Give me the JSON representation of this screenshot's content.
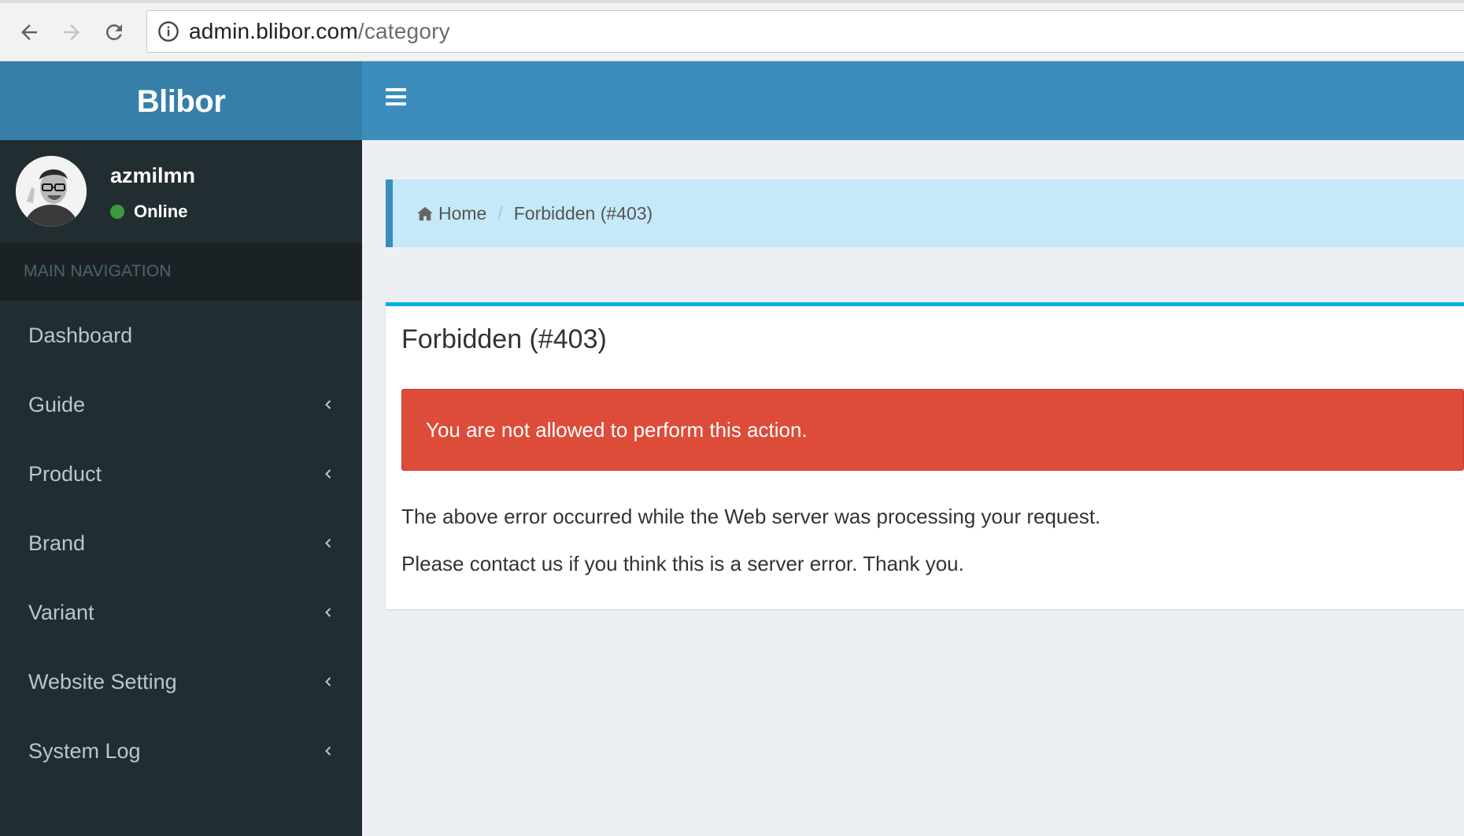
{
  "browser": {
    "url_host": "admin.blibor.com",
    "url_path": "/category"
  },
  "header": {
    "logo": "Blibor"
  },
  "sidebar": {
    "user": {
      "name": "azmilmn",
      "status": "Online"
    },
    "nav_header": "MAIN NAVIGATION",
    "items": [
      {
        "label": "Dashboard",
        "has_chevron": false
      },
      {
        "label": "Guide",
        "has_chevron": true
      },
      {
        "label": "Product",
        "has_chevron": true
      },
      {
        "label": "Brand",
        "has_chevron": true
      },
      {
        "label": "Variant",
        "has_chevron": true
      },
      {
        "label": "Website Setting",
        "has_chevron": true
      },
      {
        "label": "System Log",
        "has_chevron": true
      }
    ]
  },
  "breadcrumb": {
    "home": "Home",
    "current": "Forbidden (#403)"
  },
  "error": {
    "title": "Forbidden (#403)",
    "alert": "You are not allowed to perform this action.",
    "message1": "The above error occurred while the Web server was processing your request.",
    "message2": "Please contact us if you think this is a server error. Thank you."
  },
  "colors": {
    "header_logo_bg": "#367fa9",
    "header_bg": "#3c8dbc",
    "sidebar_bg": "#222d32",
    "alert_danger": "#dd4b39",
    "status_online": "#3c9a3c"
  }
}
